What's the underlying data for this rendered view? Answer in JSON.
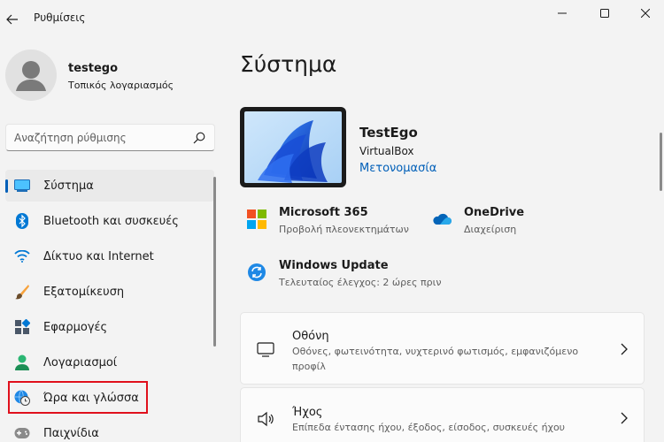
{
  "window": {
    "title": "Ρυθμίσεις"
  },
  "profile": {
    "name": "testego",
    "account_type": "Τοπικός λογαριασμός"
  },
  "search": {
    "placeholder": "Αναζήτηση ρύθμισης"
  },
  "sidebar": {
    "items": [
      {
        "label": "Σύστημα",
        "icon": "system-icon",
        "active": true
      },
      {
        "label": "Bluetooth και συσκευές",
        "icon": "bluetooth-icon"
      },
      {
        "label": "Δίκτυο και Internet",
        "icon": "wifi-icon"
      },
      {
        "label": "Εξατομίκευση",
        "icon": "brush-icon"
      },
      {
        "label": "Εφαρμογές",
        "icon": "apps-icon"
      },
      {
        "label": "Λογαριασμοί",
        "icon": "account-icon"
      },
      {
        "label": "Ώρα και γλώσσα",
        "icon": "time-language-icon",
        "highlighted": true
      },
      {
        "label": "Παιχνίδια",
        "icon": "gamepad-icon"
      }
    ]
  },
  "main": {
    "title": "Σύστημα",
    "device": {
      "name": "TestEgo",
      "model": "VirtualBox",
      "rename_label": "Μετονομασία"
    },
    "quick_links": {
      "microsoft365": {
        "title": "Microsoft 365",
        "subtitle": "Προβολή πλεονεκτημάτων"
      },
      "onedrive": {
        "title": "OneDrive",
        "subtitle": "Διαχείριση"
      },
      "windows_update": {
        "title": "Windows Update",
        "subtitle": "Τελευταίος έλεγχος: 2 ώρες πριν"
      }
    },
    "cards": {
      "display": {
        "title": "Οθόνη",
        "subtitle": "Οθόνες, φωτεινότητα, νυχτερινό φωτισμός, εμφανιζόμενο προφίλ"
      },
      "sound": {
        "title": "Ήχος",
        "subtitle": "Επίπεδα έντασης ήχου, έξοδος, είσοδος, συσκευές ήχου"
      }
    }
  },
  "colors": {
    "accent": "#005fb8",
    "highlight": "#e0101c",
    "background": "#f3f3f3"
  }
}
